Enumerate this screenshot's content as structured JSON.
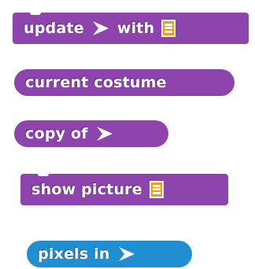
{
  "blocks": {
    "update": {
      "word1": "update",
      "word2": "with",
      "color": "#8e44ad"
    },
    "current_costume": {
      "label": "current costume",
      "color": "#8e44ad"
    },
    "copy_of": {
      "label": "copy of",
      "color": "#8e44ad"
    },
    "show_picture": {
      "label": "show picture",
      "color": "#8e44ad"
    },
    "pixels_in": {
      "label": "pixels in",
      "color": "#1f8fd1"
    }
  },
  "icons": {
    "arrow": "chevron-arrow-icon",
    "list": "list-icon"
  }
}
